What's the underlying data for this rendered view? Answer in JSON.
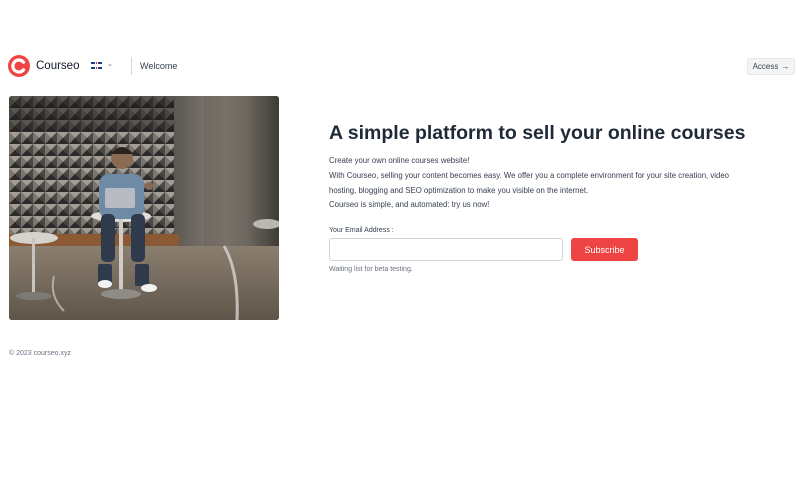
{
  "header": {
    "brand": "Courseo",
    "language_flag": "uk-flag-icon",
    "language_chevron": "⌄",
    "welcome": "Welcome",
    "access_label": "Access",
    "access_arrow": "→"
  },
  "hero": {
    "headline": "A simple platform to sell your online courses",
    "paragraphs": [
      "Create your own online courses website!",
      "With Courseo, selling your content becomes easy. We offer you a complete environment for your site creation, video",
      "hosting, blogging and SEO optimization to make you visible on the internet.",
      "Courseo is simple, and automated: try us now!"
    ],
    "image": "person-working-on-laptop-photo"
  },
  "form": {
    "email_label": "Your Email Address :",
    "email_value": "",
    "email_placeholder": "",
    "subscribe_label": "Subscribe",
    "hint": "Waiting list for beta testing."
  },
  "footer": {
    "copyright": "© 2023 courseo.xyz"
  },
  "colors": {
    "accent": "#ef4444",
    "text": "#1f2937",
    "muted": "#6b7280"
  }
}
